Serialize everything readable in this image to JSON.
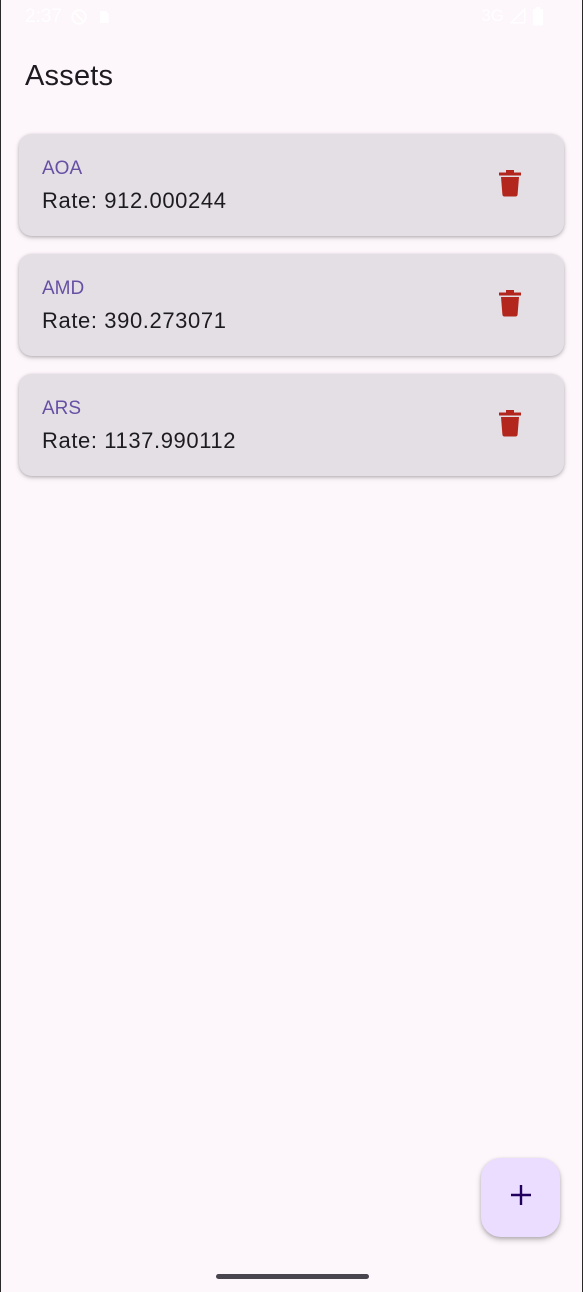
{
  "status_bar": {
    "time": "2:37",
    "network": "3G",
    "icons": [
      "do-not-disturb-icon",
      "sim-card-icon",
      "signal-icon",
      "battery-icon"
    ]
  },
  "page": {
    "title": "Assets"
  },
  "assets": [
    {
      "code": "AOA",
      "rate": "Rate: 912.000244"
    },
    {
      "code": "AMD",
      "rate": "Rate: 390.273071"
    },
    {
      "code": "ARS",
      "rate": "Rate: 1137.990112"
    }
  ],
  "fab": {
    "icon": "plus-icon"
  },
  "colors": {
    "background": "#fdf6fb",
    "card": "#e3dfe5",
    "accent": "#6750a4",
    "delete": "#b3261e",
    "fab": "#eaddff",
    "fab_icon": "#21005d"
  }
}
